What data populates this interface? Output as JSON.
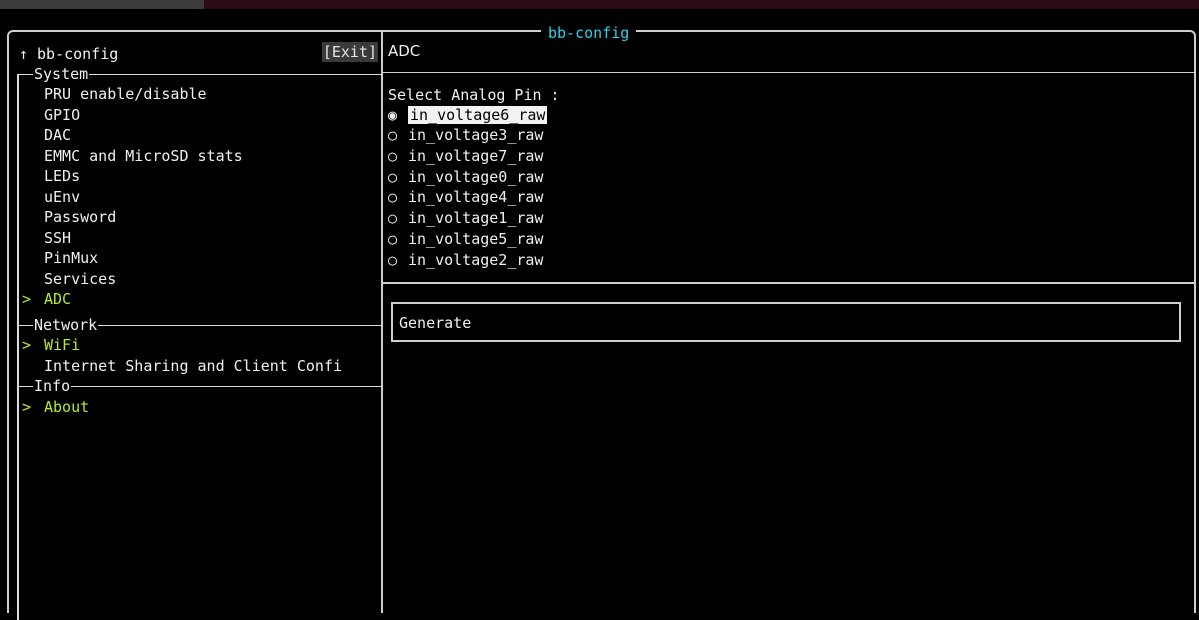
{
  "window": {
    "title": "bb-config"
  },
  "left_header": {
    "arrow": "↑",
    "title": "bb-config",
    "exit_label": "[Exit]"
  },
  "right_header": {
    "title": "ADC"
  },
  "sections": [
    {
      "label": "System",
      "items": [
        "PRU enable/disable",
        "GPIO",
        "DAC",
        "EMMC and MicroSD stats",
        "LEDs",
        "uEnv",
        "Password",
        "SSH",
        "PinMux",
        "Services",
        "ADC"
      ]
    },
    {
      "label": "Network",
      "items": [
        "WiFi",
        "Internet Sharing and Client Confi"
      ]
    },
    {
      "label": "Info",
      "items": [
        "About"
      ]
    }
  ],
  "menu_marker": ">",
  "adc": {
    "select_label": "Select Analog Pin :",
    "selected_bullet": "◉",
    "unselected_bullet": "○",
    "pins": [
      "in_voltage6_raw",
      "in_voltage3_raw",
      "in_voltage7_raw",
      "in_voltage0_raw",
      "in_voltage4_raw",
      "in_voltage1_raw",
      "in_voltage5_raw",
      "in_voltage2_raw"
    ],
    "selected_pin": "in_voltage6_raw",
    "generate_label": "Generate"
  },
  "colors": {
    "accent_title": "#29d4e8",
    "active_item": "#b6ed24",
    "background": "#000000"
  }
}
